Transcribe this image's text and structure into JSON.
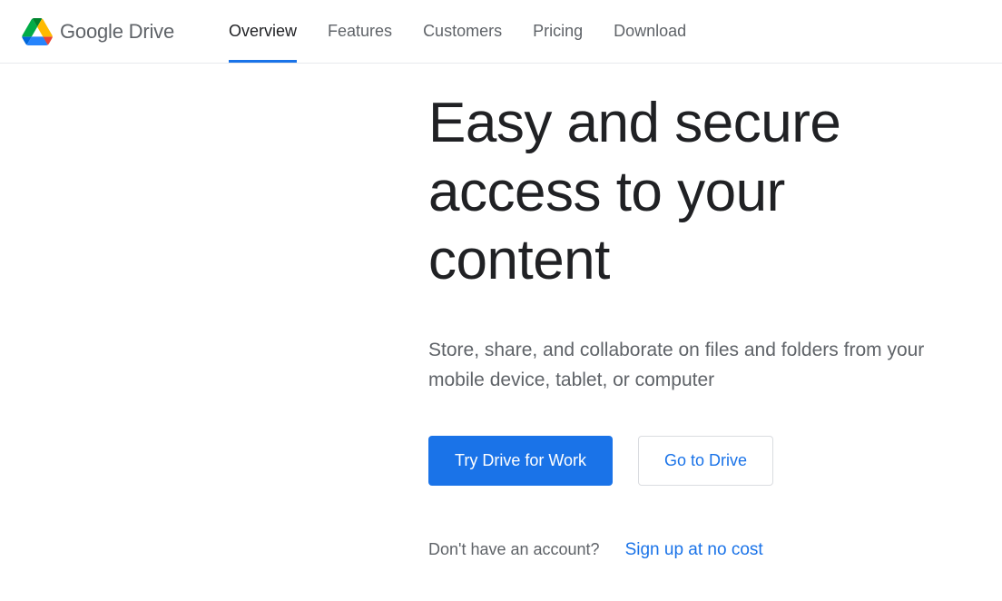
{
  "logo": {
    "brand_bold": "Google",
    "brand_light": " Drive"
  },
  "nav": {
    "items": [
      {
        "label": "Overview",
        "active": true
      },
      {
        "label": "Features",
        "active": false
      },
      {
        "label": "Customers",
        "active": false
      },
      {
        "label": "Pricing",
        "active": false
      },
      {
        "label": "Download",
        "active": false
      }
    ]
  },
  "hero": {
    "title": "Easy and secure access to your content",
    "subtitle": "Store, share, and collaborate on files and folders from your mobile device, tablet, or computer",
    "primary_cta": "Try Drive for Work",
    "secondary_cta": "Go to Drive",
    "signup_question": "Don't have an account?",
    "signup_link": "Sign up at no cost"
  },
  "colors": {
    "accent": "#1a73e8",
    "text_primary": "#202124",
    "text_secondary": "#5f6368",
    "border": "#dadce0"
  }
}
